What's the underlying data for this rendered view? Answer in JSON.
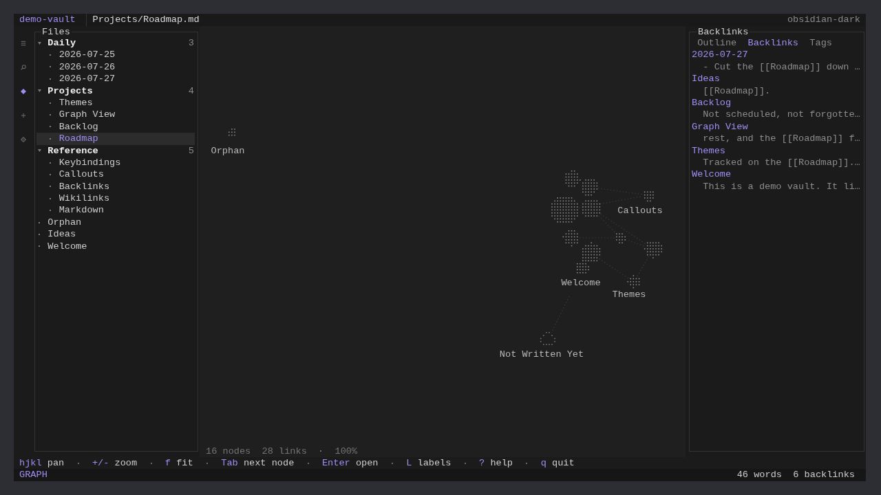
{
  "top_bar": {
    "vault": "demo-vault",
    "path": "Projects/Roadmap.md",
    "theme": "obsidian-dark"
  },
  "ribbon": [
    {
      "selected": false
    },
    {
      "selected": false
    },
    {
      "selected": true
    },
    {
      "selected": false
    },
    {
      "selected": false
    }
  ],
  "files": {
    "title": "Files",
    "tree": [
      {
        "label": "Daily",
        "kind": "folder",
        "count": "3",
        "expanded": true,
        "selected": false,
        "children": [
          {
            "label": "2026-07-25",
            "kind": "file",
            "selected": false
          },
          {
            "label": "2026-07-26",
            "kind": "file",
            "selected": false
          },
          {
            "label": "2026-07-27",
            "kind": "file",
            "selected": false
          }
        ]
      },
      {
        "label": "Projects",
        "kind": "folder",
        "count": "4",
        "expanded": true,
        "selected": false,
        "children": [
          {
            "label": "Themes",
            "kind": "file",
            "selected": false
          },
          {
            "label": "Graph View",
            "kind": "file",
            "selected": false
          },
          {
            "label": "Backlog",
            "kind": "file",
            "selected": false
          },
          {
            "label": "Roadmap",
            "kind": "file",
            "selected": true
          }
        ]
      },
      {
        "label": "Reference",
        "kind": "folder",
        "count": "5",
        "expanded": true,
        "selected": false,
        "children": [
          {
            "label": "Keybindings",
            "kind": "file",
            "selected": false
          },
          {
            "label": "Callouts",
            "kind": "file",
            "selected": false
          },
          {
            "label": "Backlinks",
            "kind": "file",
            "selected": false
          },
          {
            "label": "Wikilinks",
            "kind": "file",
            "selected": false
          },
          {
            "label": "Markdown",
            "kind": "file",
            "selected": false
          }
        ]
      },
      {
        "label": "Orphan",
        "kind": "file",
        "selected": false
      },
      {
        "label": "Ideas",
        "kind": "file",
        "selected": false
      },
      {
        "label": "Welcome",
        "kind": "file",
        "selected": false
      }
    ]
  },
  "graph": {
    "nodes": [
      {
        "kind": "note",
        "label": "Orphan"
      },
      {
        "kind": "note"
      },
      {
        "kind": "note"
      },
      {
        "kind": "note"
      },
      {
        "kind": "note"
      },
      {
        "kind": "note"
      },
      {
        "kind": "note"
      },
      {
        "kind": "note",
        "label": "Welcome"
      },
      {
        "kind": "note",
        "label": "Callouts"
      },
      {
        "kind": "note"
      },
      {
        "kind": "note"
      },
      {
        "kind": "note",
        "label": "Themes"
      },
      {
        "kind": "unresolved",
        "label": "Not Written Yet"
      }
    ],
    "status": {
      "nodes": "16 nodes",
      "links": "28 links",
      "zoom": "100%"
    }
  },
  "backlinks": {
    "title": "Backlinks",
    "tabs": [
      {
        "label": "Outline",
        "selected": false
      },
      {
        "label": "Backlinks",
        "selected": true
      },
      {
        "label": "Tags",
        "selected": false
      }
    ],
    "items": [
      {
        "source": "2026-07-27",
        "excerpt": "- Cut the [[Roadmap]] down …"
      },
      {
        "source": "Ideas",
        "excerpt": "[[Roadmap]]."
      },
      {
        "source": "Backlog",
        "excerpt": "Not scheduled, not forgotte…"
      },
      {
        "source": "Graph View",
        "excerpt": "rest, and the [[Roadmap]] f…"
      },
      {
        "source": "Themes",
        "excerpt": "Tracked on the [[Roadmap]].…"
      },
      {
        "source": "Welcome",
        "excerpt": "This is a demo vault. It li…"
      }
    ]
  },
  "keybar": [
    {
      "key": "hjkl",
      "action": "pan"
    },
    {
      "key": "+/-",
      "action": "zoom"
    },
    {
      "key": "f",
      "action": "fit"
    },
    {
      "key": "Tab",
      "action": "next node"
    },
    {
      "key": "Enter",
      "action": "open"
    },
    {
      "key": "L",
      "action": "labels"
    },
    {
      "key": "?",
      "action": "help"
    },
    {
      "key": "q",
      "action": "quit"
    }
  ],
  "mode_line": {
    "mode": "GRAPH",
    "words": "46 words",
    "backlinks": "6 backlinks"
  }
}
